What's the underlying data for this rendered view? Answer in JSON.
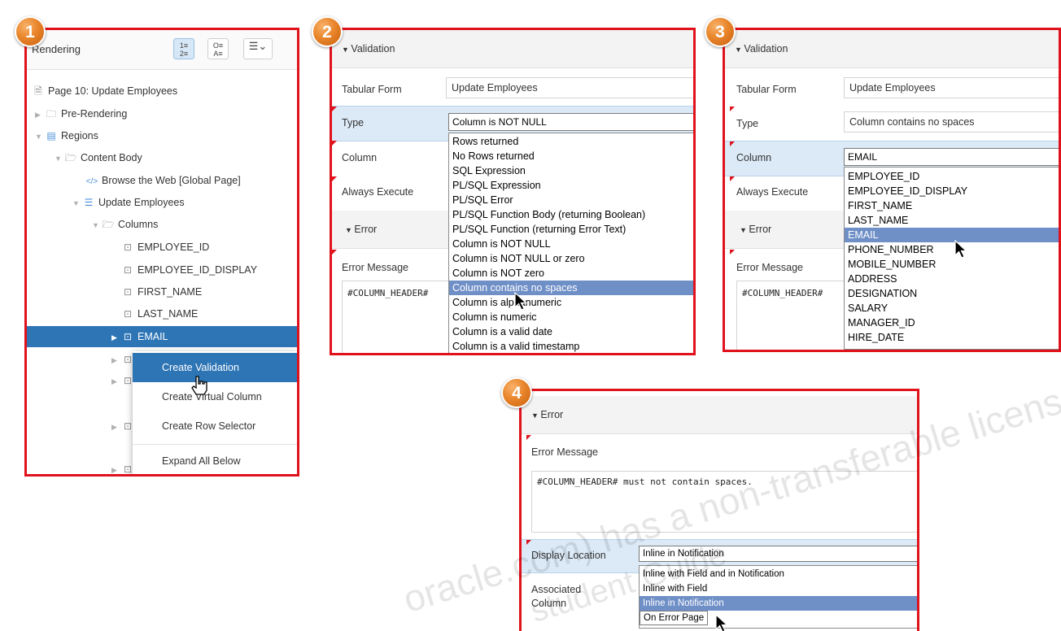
{
  "badges": [
    "1",
    "2",
    "3",
    "4"
  ],
  "panel1": {
    "title": "Rendering",
    "toolbar_icons": [
      "numbered-list-icon",
      "sort-az-icon",
      "view-menu-icon"
    ],
    "tree": [
      {
        "label": "Page 10: Update Employees",
        "icon": "page-icon"
      },
      {
        "label": "Pre-Rendering",
        "icon": "folder-icon"
      },
      {
        "label": "Regions",
        "icon": "region-icon"
      },
      {
        "label": "Content Body",
        "icon": "folder-open-icon"
      },
      {
        "label": "Browse the Web [Global Page]",
        "icon": "code-icon"
      },
      {
        "label": "Update Employees",
        "icon": "tabular-form-icon"
      },
      {
        "label": "Columns",
        "icon": "folder-open-icon"
      },
      {
        "label": "EMPLOYEE_ID",
        "icon": "column-icon"
      },
      {
        "label": "EMPLOYEE_ID_DISPLAY",
        "icon": "column-icon"
      },
      {
        "label": "FIRST_NAME",
        "icon": "column-icon"
      },
      {
        "label": "LAST_NAME",
        "icon": "column-icon"
      },
      {
        "label": "EMAIL",
        "icon": "column-icon"
      }
    ],
    "context_menu": [
      "Create Validation",
      "Create Virtual Column",
      "Create Row Selector",
      "Expand All Below"
    ]
  },
  "panel2": {
    "section_validation": "Validation",
    "section_error": "Error",
    "labels": {
      "tabular_form": "Tabular Form",
      "type": "Type",
      "column": "Column",
      "always_execute": "Always Execute",
      "error_message": "Error Message"
    },
    "tabular_form_value": "Update Employees",
    "type_value": "Column is NOT NULL",
    "error_message_value": "#COLUMN_HEADER#",
    "type_options": [
      "Rows returned",
      "No Rows returned",
      "SQL Expression",
      "PL/SQL Expression",
      "PL/SQL Error",
      "PL/SQL Function Body (returning Boolean)",
      "PL/SQL Function (returning Error Text)",
      "Column is NOT NULL",
      "Column is NOT NULL or zero",
      "Column is NOT zero",
      "Column contains no spaces",
      "Column is alphanumeric",
      "Column is numeric",
      "Column is a valid date",
      "Column is a valid timestamp"
    ],
    "highlighted_option": "Column contains no spaces"
  },
  "panel3": {
    "section_validation": "Validation",
    "section_error": "Error",
    "labels": {
      "tabular_form": "Tabular Form",
      "type": "Type",
      "column": "Column",
      "always_execute": "Always Execute",
      "error_message": "Error Message"
    },
    "tabular_form_value": "Update Employees",
    "type_value": "Column contains no spaces",
    "column_value": "EMAIL",
    "error_message_value": "#COLUMN_HEADER#",
    "column_options": [
      "EMPLOYEE_ID",
      "EMPLOYEE_ID_DISPLAY",
      "FIRST_NAME",
      "LAST_NAME",
      "EMAIL",
      "PHONE_NUMBER",
      "MOBILE_NUMBER",
      "ADDRESS",
      "DESIGNATION",
      "SALARY",
      "MANAGER_ID",
      "HIRE_DATE"
    ],
    "highlighted_option": "EMAIL"
  },
  "panel4": {
    "section_error": "Error",
    "labels": {
      "error_message": "Error Message",
      "display_location": "Display Location",
      "associated_column": "Associated Column"
    },
    "error_message_value": "#COLUMN_HEADER# must not contain spaces.",
    "display_location_value": "Inline in Notification",
    "location_options": [
      "Inline with Field and in Notification",
      "Inline with Field",
      "Inline in Notification",
      "On Error Page"
    ],
    "highlighted_option": "Inline in Notification"
  },
  "watermark": "oracle.com) has a non-transferable license",
  "watermark2": "student Guide"
}
